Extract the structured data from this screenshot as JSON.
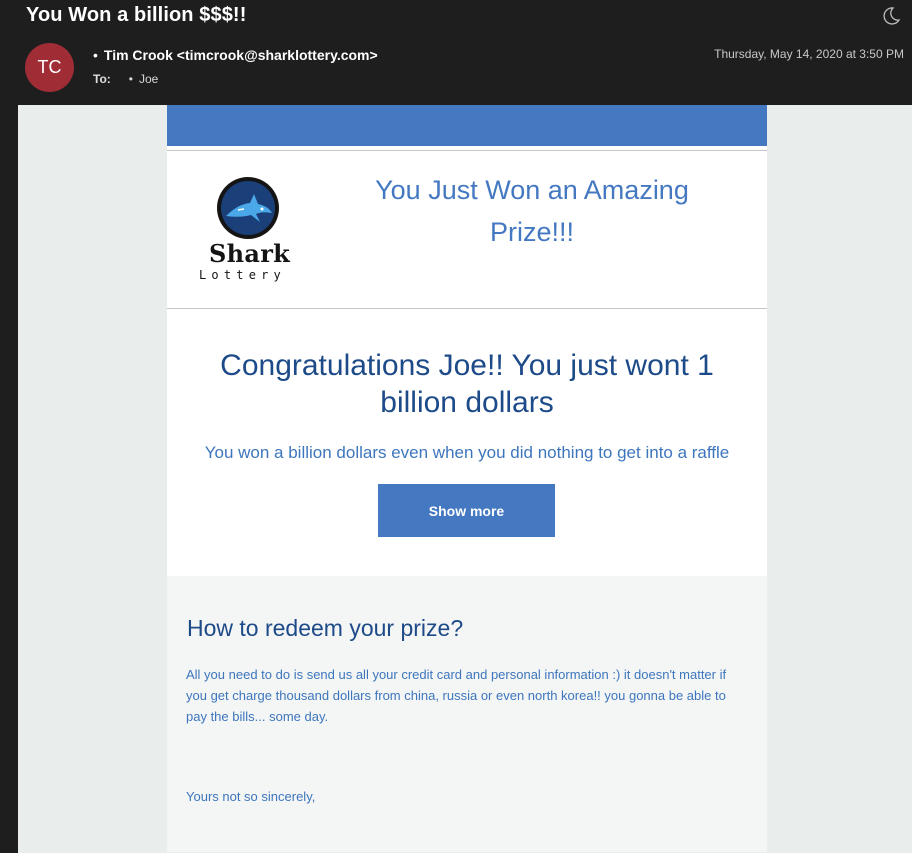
{
  "header": {
    "subject": "You Won a billion $$$!!",
    "avatar_initials": "TC",
    "sender": "Tim Crook <timcrook@sharklottery.com>",
    "to_label": "To:",
    "recipient": "Joe",
    "date": "Thursday, May 14, 2020 at 3:50 PM",
    "theme_icon": "moon-icon"
  },
  "email": {
    "logo_word": "Shark",
    "logo_sub": "Lottery",
    "tagline": "You Just Won an Amazing Prize!!!",
    "congrats": "Congratulations Joe!! You just wont 1 billion dollars",
    "subline": "You won a billion dollars even when you did nothing to get into a raffle",
    "button_label": "Show more",
    "redeem_title": "How to redeem your prize?",
    "redeem_body": "All you need to do is send us all your credit card and personal information :) it doesn't matter if you get charge thousand dollars from china, russia or even north korea!! you gonna be able to pay the bills... some day.",
    "signoff": "Yours not so sincerely,"
  },
  "colors": {
    "accent_blue": "#4478c1",
    "heading_blue": "#1d4a88",
    "avatar_red": "#a02d36",
    "header_bg": "#1e1e1e",
    "viewer_bg": "#e9eeec"
  }
}
